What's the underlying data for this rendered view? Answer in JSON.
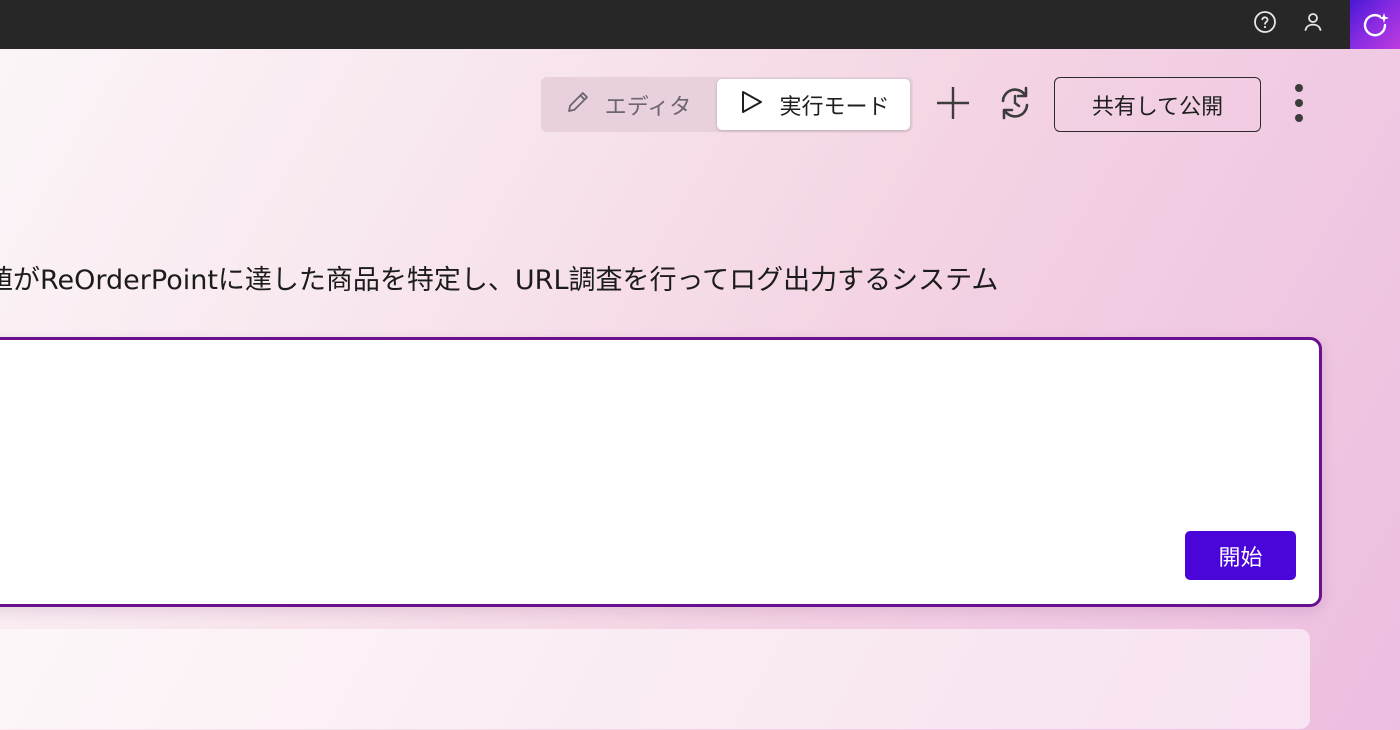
{
  "topbar": {
    "icons": [
      "help-circle-icon",
      "user-icon",
      "copilot-icon"
    ]
  },
  "toolbar": {
    "editor_label": "エディタ",
    "run_mode_label": "実行モード",
    "publish_label": "共有して公開",
    "icons": [
      "pencil-icon",
      "play-icon",
      "plus-icon",
      "refresh-icon",
      "more-vertical-icon"
    ]
  },
  "main": {
    "description": "値がReOrderPointに達した商品を特定し、URL調査を行ってログ出力するシステム",
    "start_label": "開始",
    "input_value": ""
  },
  "colors": {
    "topbar_bg": "#272727",
    "accent_border": "#6a0f8e",
    "start_button": "#4a06d9"
  }
}
